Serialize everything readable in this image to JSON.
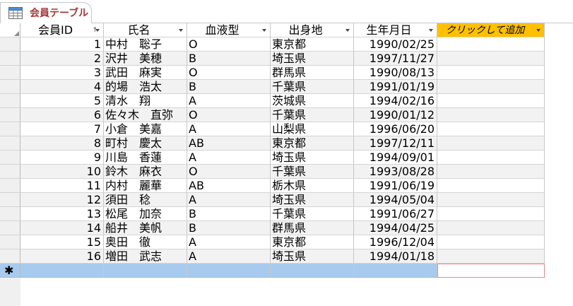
{
  "tab": {
    "label": "会員テーブル"
  },
  "columns": [
    {
      "key": "id",
      "label": "会員ID"
    },
    {
      "key": "name",
      "label": "氏名"
    },
    {
      "key": "blood",
      "label": "血液型"
    },
    {
      "key": "home",
      "label": "出身地"
    },
    {
      "key": "birth",
      "label": "生年月日"
    },
    {
      "key": "add",
      "label": "クリックして追加"
    }
  ],
  "rows": [
    {
      "id": "1",
      "name": "中村　聡子",
      "blood": "O",
      "home": "東京都",
      "birth": "1990/02/25"
    },
    {
      "id": "2",
      "name": "沢井　美穂",
      "blood": "B",
      "home": "埼玉県",
      "birth": "1997/11/27"
    },
    {
      "id": "3",
      "name": "武田　麻実",
      "blood": "O",
      "home": "群馬県",
      "birth": "1990/08/13"
    },
    {
      "id": "4",
      "name": "的場　浩太",
      "blood": "B",
      "home": "千葉県",
      "birth": "1991/01/19"
    },
    {
      "id": "5",
      "name": "清水　翔",
      "blood": "A",
      "home": "茨城県",
      "birth": "1994/02/16"
    },
    {
      "id": "6",
      "name": "佐々木　直弥",
      "blood": "O",
      "home": "千葉県",
      "birth": "1990/01/12"
    },
    {
      "id": "7",
      "name": "小倉　美嘉",
      "blood": "A",
      "home": "山梨県",
      "birth": "1996/06/20"
    },
    {
      "id": "8",
      "name": "町村　慶太",
      "blood": "AB",
      "home": "東京都",
      "birth": "1997/12/11"
    },
    {
      "id": "9",
      "name": "川島　香蓮",
      "blood": "A",
      "home": "埼玉県",
      "birth": "1994/09/01"
    },
    {
      "id": "10",
      "name": "鈴木　麻衣",
      "blood": "O",
      "home": "千葉県",
      "birth": "1993/08/28"
    },
    {
      "id": "11",
      "name": "内村　麗華",
      "blood": "AB",
      "home": "栃木県",
      "birth": "1991/06/19"
    },
    {
      "id": "12",
      "name": "須田　稔",
      "blood": "A",
      "home": "埼玉県",
      "birth": "1994/05/04"
    },
    {
      "id": "13",
      "name": "松尾　加奈",
      "blood": "B",
      "home": "千葉県",
      "birth": "1991/06/27"
    },
    {
      "id": "14",
      "name": "船井　美帆",
      "blood": "B",
      "home": "群馬県",
      "birth": "1994/04/25"
    },
    {
      "id": "15",
      "name": "奥田　徹",
      "blood": "A",
      "home": "東京都",
      "birth": "1996/12/04"
    },
    {
      "id": "16",
      "name": "増田　武志",
      "blood": "A",
      "home": "埼玉県",
      "birth": "1994/01/18"
    }
  ],
  "new_row": {
    "marker": "✱"
  },
  "icons": {
    "tab": "table-icon",
    "header_dropdown": "dropdown-arrow-icon",
    "sort": "sort-ascending-icon",
    "select_all": "select-all-corner-icon"
  },
  "colors": {
    "tab_label": "#a4373a",
    "add_column_header": "#ffc000",
    "new_row": "#a7cbee",
    "alt_row": "#f2f2f2"
  }
}
